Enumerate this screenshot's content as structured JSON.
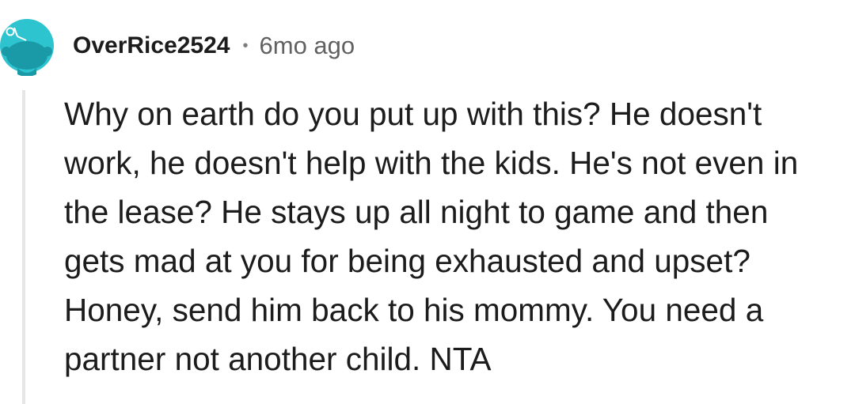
{
  "comment": {
    "username": "OverRice2524",
    "separator": "•",
    "timestamp": "6mo ago",
    "avatar_icon": "snoo-avatar-icon",
    "body_lines": [
      "Why on earth do you put up with this? He doesn't",
      "work, he doesn't help with the kids. He's not even in",
      "the lease? He stays up all night to game and then",
      "gets mad at you for being exhausted and upset?",
      "Honey, send him back to his mommy. You need a",
      "partner not another child. NTA"
    ]
  },
  "colors": {
    "avatar_bg": "#2dc3cf",
    "avatar_head": "#1a9aa6",
    "username": "#1c1c1c",
    "meta": "#616161",
    "thread_line": "#e6e6e6"
  }
}
